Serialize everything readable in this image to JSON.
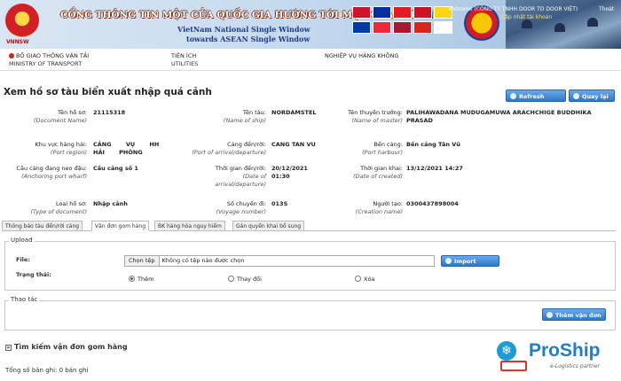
{
  "banner": {
    "logo_text": "VNNSW",
    "title": "CỔNG THÔNG TIN MỘT CỬA QUỐC GIA HƯỚNG TỚI MỘT CỬA ASEAN",
    "subtitle_line1": "VietNam National Single Window",
    "subtitle_line2": "towards ASEAN Single Window",
    "user_text": "Welcome (CÔNG TY TNHH DOOR TO DOOR VIỆT)",
    "hello_text": "Cập nhật tài khoản",
    "logout_label": "Thoát",
    "flag_colors": [
      "#cf142b",
      "#032ea1",
      "#e31b23",
      "#ce1126",
      "#f9d616",
      "#0038a8",
      "#ed2939",
      "#a51931",
      "#da251d",
      "#fff"
    ]
  },
  "nav": {
    "items": [
      {
        "title": "BỘ GIAO THÔNG VẬN TẢI",
        "sub": "MINISTRY OF TRANSPORT"
      },
      {
        "title": "TIỆN ÍCH",
        "sub": "UTILITIES"
      },
      {
        "title": "NGHIỆP VỤ HÀNG KHÔNG",
        "sub": ""
      }
    ]
  },
  "page": {
    "title": "Xem hồ sơ tàu biển xuất nhập quá cảnh",
    "refresh_label": "Refresh",
    "back_label": "Quay lại"
  },
  "info": {
    "doc_no": {
      "label": "Tên hồ sơ:",
      "en": "(Document Name)",
      "value": "21115318"
    },
    "ship_name": {
      "label": "Tên tàu:",
      "en": "(Name of ship)",
      "value": "NORDAMSTEL"
    },
    "master": {
      "label": "Tên thuyền trưởng:",
      "en": "(Name of master)",
      "value": "PALIHAWADANA MUDUGAMUWA ARACHCHIGE BUDDHIKA PRASAD"
    },
    "port_region": {
      "label": "Khu vực hàng hải:",
      "en": "(Port region)",
      "value": "CẢNG VỤ HH HẢI PHÒNG"
    },
    "port_arrival": {
      "label": "Cảng đến/rời:",
      "en": "(Port of arrival/departure)",
      "value": "CANG TAN VU"
    },
    "harbour": {
      "label": "Bến cảng:",
      "en": "(Port harbour)",
      "value": "Bến cảng Tân Vũ"
    },
    "anchoring": {
      "label": "Cầu cảng đang neo đậu:",
      "en": "(Anchoring port wharf)",
      "value": "Cầu cảng số 1"
    },
    "arrival_time": {
      "label": "Thời gian đến/rời:",
      "en": "(Date of arrival/departure)",
      "value": "20/12/2021 01:30"
    },
    "created_time": {
      "label": "Thời gian khai:",
      "en": "(Date of created)",
      "value": "13/12/2021 14:27"
    },
    "doc_type": {
      "label": "Loại hồ sơ:",
      "en": "(Type of document)",
      "value": "Nhập cảnh"
    },
    "voyage": {
      "label": "Số chuyến đi:",
      "en": "(Voyage number)",
      "value": "013S"
    },
    "creator": {
      "label": "Người tạo:",
      "en": "(Creation name)",
      "value": "0300437898004"
    }
  },
  "tabs": [
    {
      "label": "Thông báo tàu đến/rời cảng"
    },
    {
      "label": "Vận đơn gom hàng"
    },
    {
      "label": "BK hàng hóa nguy hiểm"
    },
    {
      "label": "Gán quyền khai bổ sung"
    }
  ],
  "upload": {
    "legend": "Upload",
    "file_label": "File:",
    "choose_file": "Chọn tệp",
    "no_file": "Không có tệp nào được chọn",
    "import_label": "Import",
    "status_label": "Trạng thái:",
    "options": [
      {
        "label": "Thêm",
        "selected": true
      },
      {
        "label": "Thay đổi",
        "selected": false
      },
      {
        "label": "Xóa",
        "selected": false
      }
    ]
  },
  "actions": {
    "legend": "Thao tác",
    "add_label": "Thêm vận đơn"
  },
  "search": {
    "toggle": "»",
    "title": "Tìm kiếm vận đơn gom hàng",
    "total": "Tổng số bản ghi: 0 bản ghi"
  },
  "watermark": {
    "name": "ProShip",
    "tagline": "e-Logistics partner"
  }
}
